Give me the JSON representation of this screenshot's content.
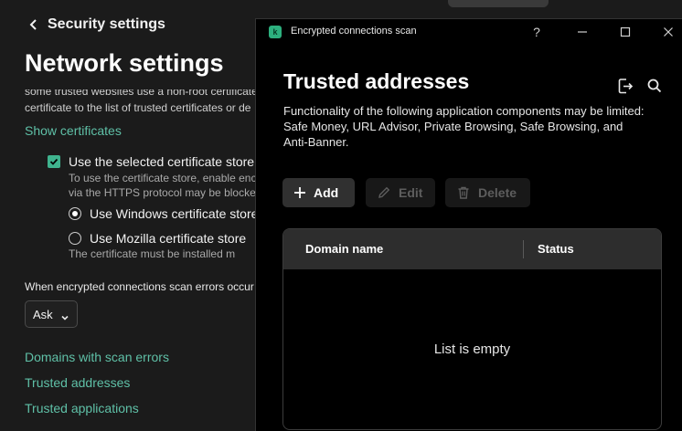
{
  "back": {
    "label": "Security settings"
  },
  "page_title": "Network settings",
  "partial_text_top": "some trusted websites use a non-root certificate",
  "partial_text_cert": "certificate to the list of trusted certificates or de",
  "show_certificates_link": "Show certificates",
  "use_store_checkbox": {
    "label": "Use the selected certificate store",
    "checked": true
  },
  "use_store_hint": [
    "To use the certificate store, enable enc",
    "via the HTTPS protocol may be blocke"
  ],
  "radio_windows": {
    "label": "Use Windows certificate store",
    "selected": true
  },
  "radio_mozilla": {
    "label": "Use Mozilla certificate store",
    "selected": false
  },
  "mozilla_hint": "The certificate must be installed m",
  "errors_label": "When encrypted connections scan errors occur",
  "errors_select": {
    "value": "Ask"
  },
  "links": {
    "domains_with_scan_errors": "Domains with scan errors",
    "trusted_addresses": "Trusted addresses",
    "trusted_applications": "Trusted applications"
  },
  "dialog": {
    "title": "Encrypted connections scan",
    "app_icon_letter": "k",
    "help_label": "?",
    "heading": "Trusted addresses",
    "description": "Functionality of the following application components may be limited: Safe Money, URL Advisor, Private Browsing, Safe Browsing, and Anti-Banner.",
    "buttons": {
      "add": "Add",
      "edit": "Edit",
      "delete": "Delete"
    },
    "table": {
      "columns": [
        "Domain name",
        "Status"
      ],
      "rows": [],
      "empty_text": "List is empty"
    }
  },
  "colors": {
    "accent": "#3fb38e",
    "link": "#5fc0a7",
    "background": "#1b1b1b",
    "dialog_bg": "#000000"
  }
}
